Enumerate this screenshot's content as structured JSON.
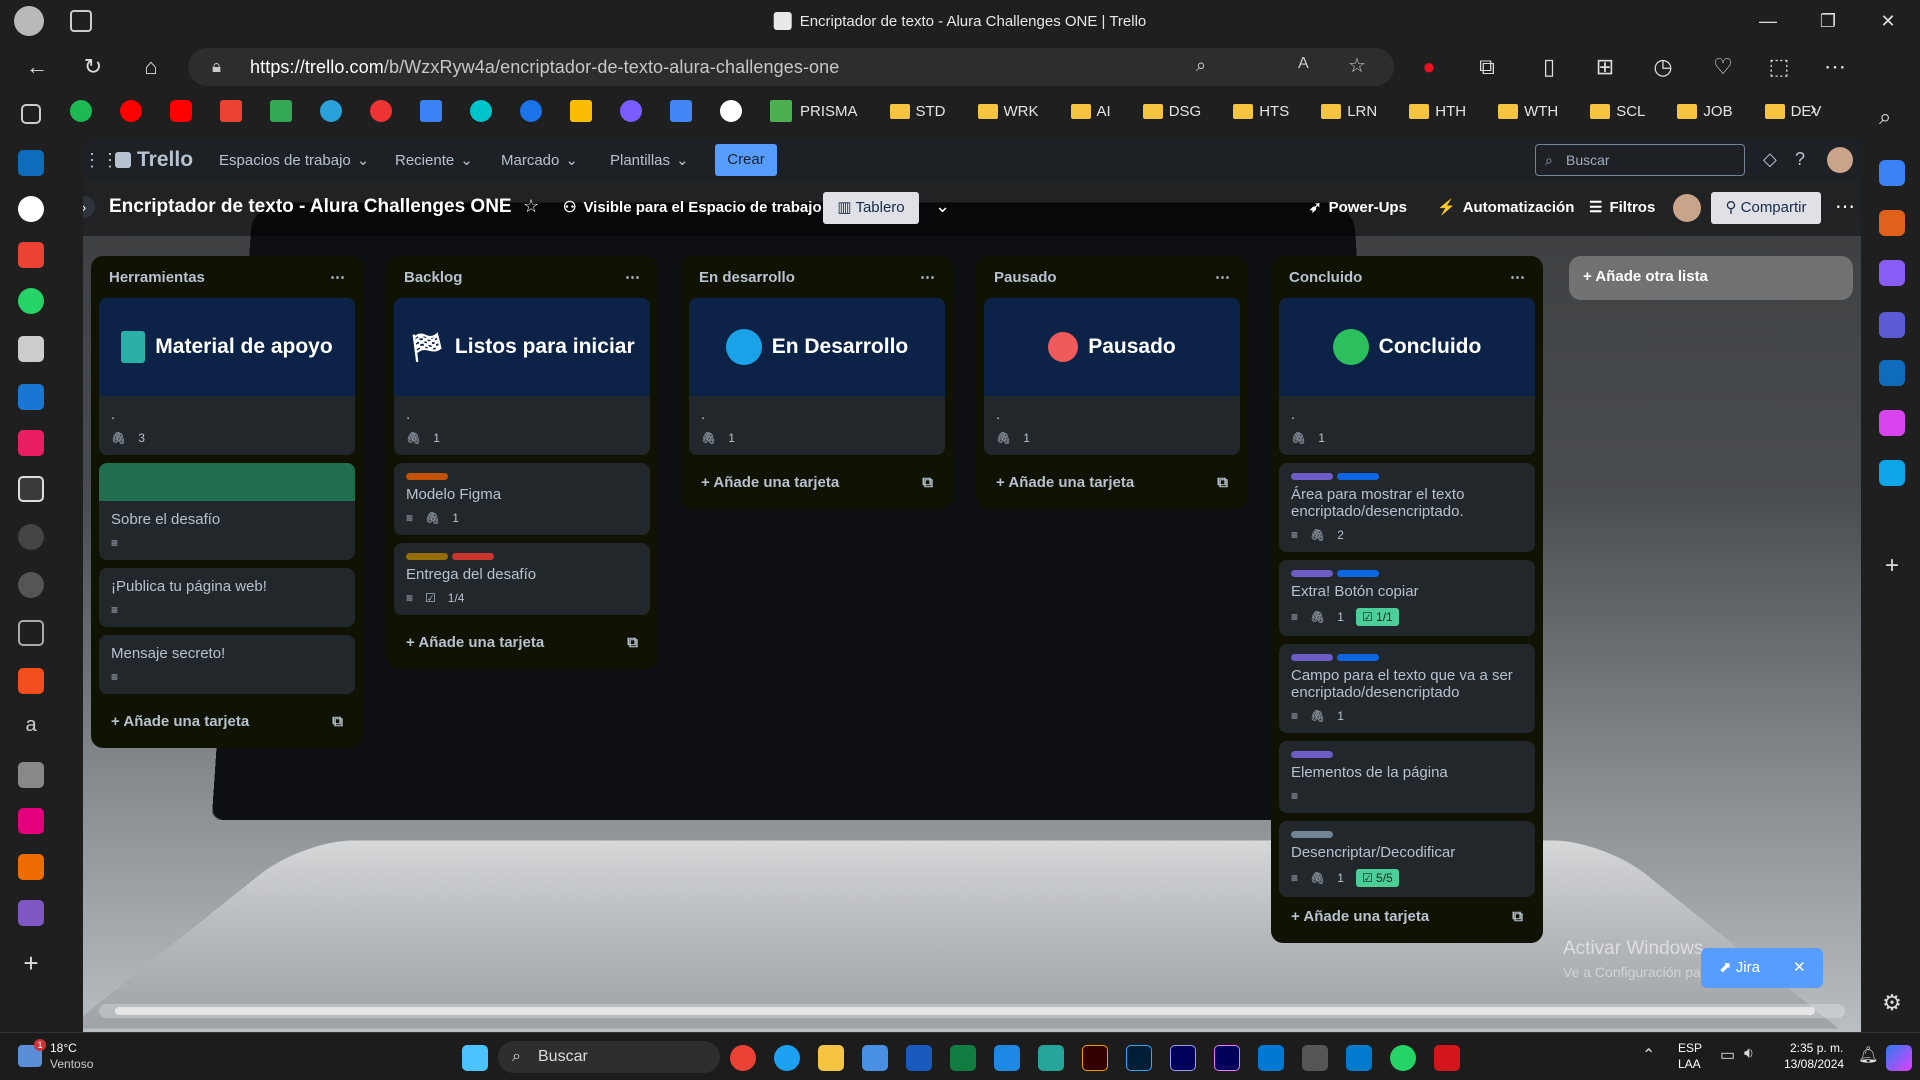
{
  "window": {
    "title": "Encriptador de texto - Alura Challenges ONE | Trello"
  },
  "browser": {
    "url_domain": "https://trello.com",
    "url_path": "/b/WzxRyw4a/encriptador-de-texto-alura-challenges-one",
    "bookmarks": [
      "PRISMA",
      "STD",
      "WRK",
      "AI",
      "DSG",
      "HTS",
      "LRN",
      "HTH",
      "WTH",
      "SCL",
      "JOB",
      "DEV"
    ]
  },
  "trello": {
    "logo": "Trello",
    "nav": [
      "Espacios de trabajo",
      "Reciente",
      "Marcado",
      "Plantillas"
    ],
    "create": "Crear",
    "search_placeholder": "Buscar"
  },
  "board": {
    "title": "Encriptador de texto - Alura Challenges ONE",
    "visibility": "Visible para el Espacio de trabajo",
    "view": "Tablero",
    "powerups": "Power-Ups",
    "automation": "Automatización",
    "filters": "Filtros",
    "share": "Compartir",
    "add_list": "Añade otra lista",
    "add_card": "Añade una tarjeta"
  },
  "lists": [
    {
      "name": "Herramientas",
      "cover": {
        "title": "Material de apoyo",
        "color": "#2ab0a8"
      },
      "cover_card": {
        "text": ".",
        "attachments": "3"
      },
      "cards": [
        {
          "text": "Sobre el desafío",
          "green_cover": true
        },
        {
          "text": "¡Publica tu página web!"
        },
        {
          "text": "Mensaje secreto!"
        }
      ]
    },
    {
      "name": "Backlog",
      "cover": {
        "title": "Listos para iniciar",
        "color": "#ffffff"
      },
      "cover_card": {
        "text": ".",
        "attachments": "1"
      },
      "cards": [
        {
          "text": "Modelo Figma",
          "attachments": "1"
        },
        {
          "text": "Entrega del desafío",
          "checklist": "1/4"
        }
      ]
    },
    {
      "name": "En desarrollo",
      "cover": {
        "title": "En Desarrollo",
        "color": "#1aa3e8"
      },
      "cover_card": {
        "text": ".",
        "attachments": "1"
      },
      "cards": []
    },
    {
      "name": "Pausado",
      "cover": {
        "title": "Pausado",
        "color": "#f05a5a"
      },
      "cover_card": {
        "text": ".",
        "attachments": "1"
      },
      "cards": []
    },
    {
      "name": "Concluido",
      "cover": {
        "title": "Concluido",
        "color": "#2bbf5e"
      },
      "cover_card": {
        "text": ".",
        "attachments": "1"
      },
      "cards": [
        {
          "text": "Área para mostrar el texto encriptado/desencriptado.",
          "attachments": "2"
        },
        {
          "text": "Extra! Botón copiar",
          "attachments": "1",
          "checklist": "1/1"
        },
        {
          "text": "Campo para el texto que va a ser encriptado/desencriptado",
          "attachments": "1"
        },
        {
          "text": "Elementos de la página"
        },
        {
          "text": "Desencriptar/Decodificar",
          "attachments": "1",
          "checklist": "5/5"
        }
      ]
    }
  ],
  "overlay": {
    "activate_title": "Activar Windows",
    "activate_sub": "Ve a Configuración para activar Windows.",
    "jira": "Jira"
  },
  "taskbar": {
    "weather_temp": "18°C",
    "weather_desc": "Ventoso",
    "search": "Buscar",
    "lang1": "ESP",
    "lang2": "LAA",
    "time": "2:35 p. m.",
    "date": "13/08/2024",
    "weather_badge": "1"
  },
  "colors": {
    "accent": "#579dff",
    "list_bg": "#101204",
    "card_bg": "#22272b",
    "cover_bg": "#0c2347",
    "purple_label": "#6e5dc6",
    "blue_label": "#0c66e4",
    "orange_label": "#c25100",
    "yellow_label": "#946f00",
    "red_label": "#c9372c",
    "gray_label": "#738496",
    "green_cover": "#216e4e"
  }
}
